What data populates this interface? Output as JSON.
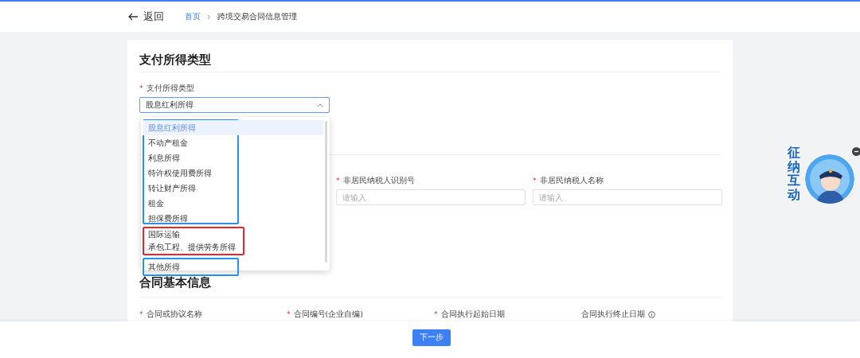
{
  "topbar": {
    "back": "返回",
    "breadcrumb": [
      {
        "label": "首页",
        "link": true
      },
      {
        "label": "跨境交易合同信息管理",
        "link": false
      }
    ]
  },
  "sections": [
    {
      "title": "支付所得类型",
      "fields": [
        {
          "kind": "select",
          "label": "支付所得类型",
          "required_mark": "*",
          "value": "股息红利所得",
          "expanded": true
        }
      ]
    },
    {
      "fields": [
        {
          "kind": "hidden"
        },
        {
          "kind": "input",
          "label": "非居民纳税人识别号",
          "required_mark": "*",
          "placeholder": "请输入"
        },
        {
          "kind": "input",
          "label": "非居民纳税人名称",
          "required_mark": "*",
          "placeholder": "请输入"
        }
      ]
    },
    {
      "title": "合同基本信息",
      "fields": [
        {
          "kind": "input",
          "label": "合同或协议名称",
          "required_mark": "*"
        },
        {
          "kind": "input",
          "label": "合同编号(企业自编)",
          "required_mark": "*"
        },
        {
          "kind": "input",
          "label": "合同执行起始日期",
          "required_mark": "*"
        },
        {
          "kind": "input",
          "label": "合同执行终止日期",
          "info": true
        }
      ]
    }
  ],
  "dropdown": {
    "groups": [
      {
        "color": "#2b8ff0",
        "options": [
          {
            "label": "股息红利所得",
            "selected": true
          },
          {
            "label": "不动产租金",
            "selected": false
          },
          {
            "label": "利息所得",
            "selected": false
          },
          {
            "label": "特许权使用费所得",
            "selected": false
          },
          {
            "label": "转让财产所得",
            "selected": false
          },
          {
            "label": "租金",
            "selected": false
          },
          {
            "label": "担保费所得",
            "selected": false
          }
        ]
      },
      {
        "color": "#e8262a",
        "options": [
          {
            "label": "国际运输",
            "selected": false
          },
          {
            "label": "承包工程、提供劳务所得",
            "selected": false
          }
        ]
      },
      {
        "color": "#2b8ff0",
        "options": [
          {
            "label": "其他所得",
            "selected": false
          }
        ]
      }
    ]
  },
  "footer": {
    "next": "下一步"
  },
  "widget": {
    "text": "征纳互动"
  }
}
